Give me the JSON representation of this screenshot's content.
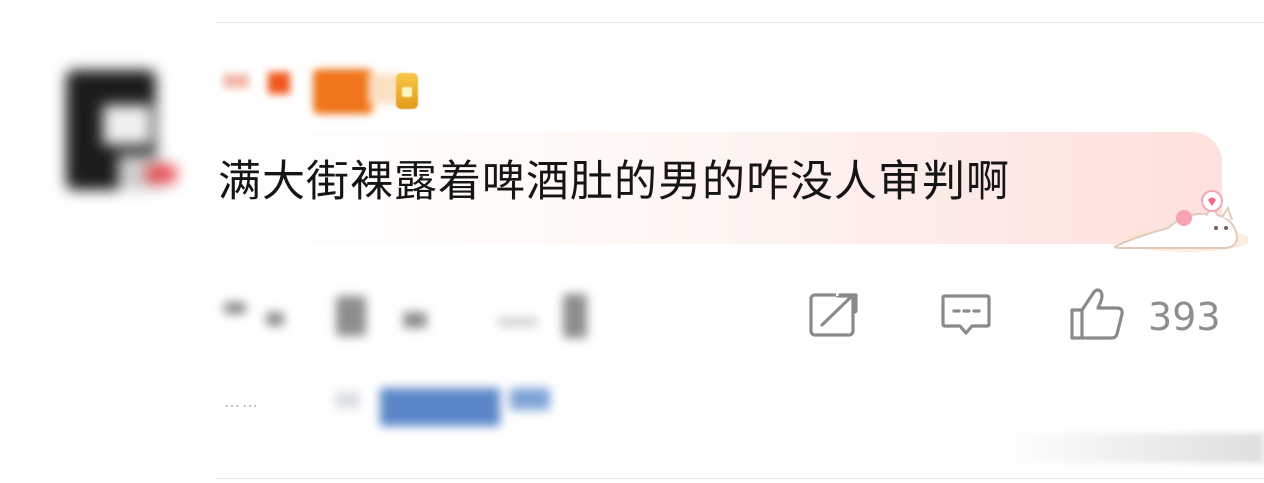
{
  "comment": {
    "text": "满大街裸露着啤酒肚的男的咋没人审判啊"
  },
  "actions": {
    "share_icon": "share-icon",
    "comment_icon": "comment-icon",
    "like_icon": "thumbs-up-icon",
    "like_count": "393"
  },
  "reply": {
    "dots": "……"
  },
  "colors": {
    "text": "#151515",
    "muted": "#8e8e8e",
    "bubble_accent": "#fde1dc"
  }
}
